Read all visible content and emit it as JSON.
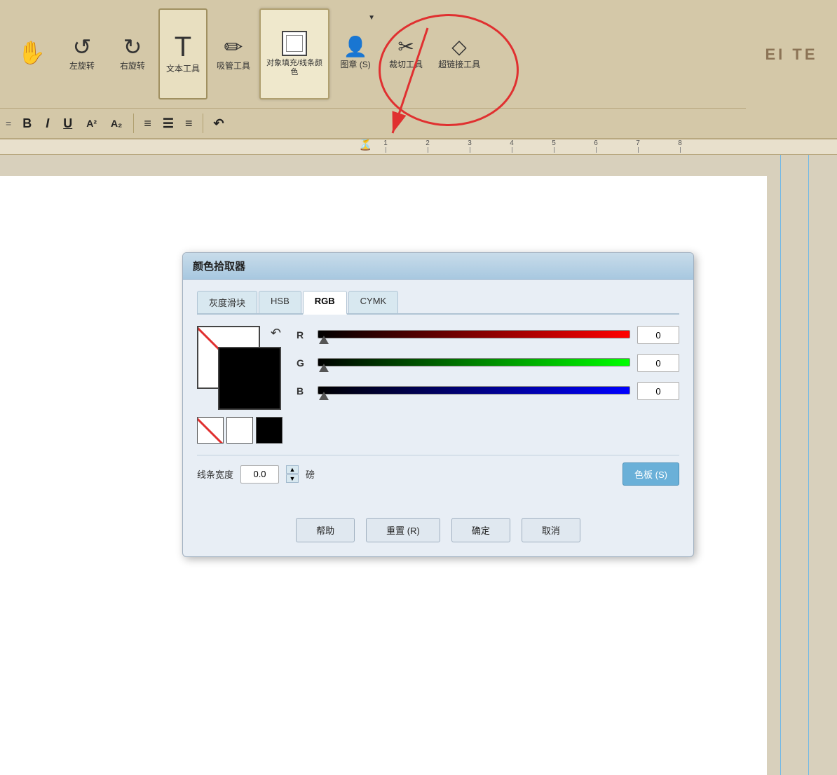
{
  "toolbar": {
    "tools": [
      {
        "id": "hand",
        "icon": "✋",
        "label": ""
      },
      {
        "id": "undo-left",
        "icon": "↺",
        "label": "左旋转"
      },
      {
        "id": "redo-right",
        "icon": "↻",
        "label": "右旋转"
      },
      {
        "id": "text",
        "icon": "T",
        "label": "文本工具"
      },
      {
        "id": "eyedrop",
        "icon": "✏",
        "label": "吸管工具"
      },
      {
        "id": "fill-stroke",
        "icon": "□",
        "label": "对象填充/线条颜\n色"
      },
      {
        "id": "stamp",
        "icon": "👤",
        "label": "图章 (S)"
      },
      {
        "id": "crop",
        "icon": "⊢",
        "label": "裁切工具"
      },
      {
        "id": "hyperlink",
        "icon": "◇",
        "label": "超链接工具"
      }
    ]
  },
  "toolbar2": {
    "bold": "B",
    "italic": "I",
    "underline": "U",
    "super": "A²",
    "sub": "A₂",
    "align_left": "≡",
    "align_center": "≡",
    "align_right": "≡",
    "undo": "↶"
  },
  "dialog": {
    "title": "颜色拾取器",
    "tabs": [
      "灰度滑块",
      "HSB",
      "RGB",
      "CYMK"
    ],
    "active_tab": "RGB",
    "r_label": "R",
    "g_label": "G",
    "b_label": "B",
    "r_value": "0",
    "g_value": "0",
    "b_value": "0",
    "line_width_label": "线条宽度",
    "line_width_value": "0.0",
    "unit_label": "磅",
    "color_board_btn": "色板 (S)",
    "help_btn": "帮助",
    "reset_btn": "重置 (R)",
    "ok_btn": "确定",
    "cancel_btn": "取消"
  }
}
